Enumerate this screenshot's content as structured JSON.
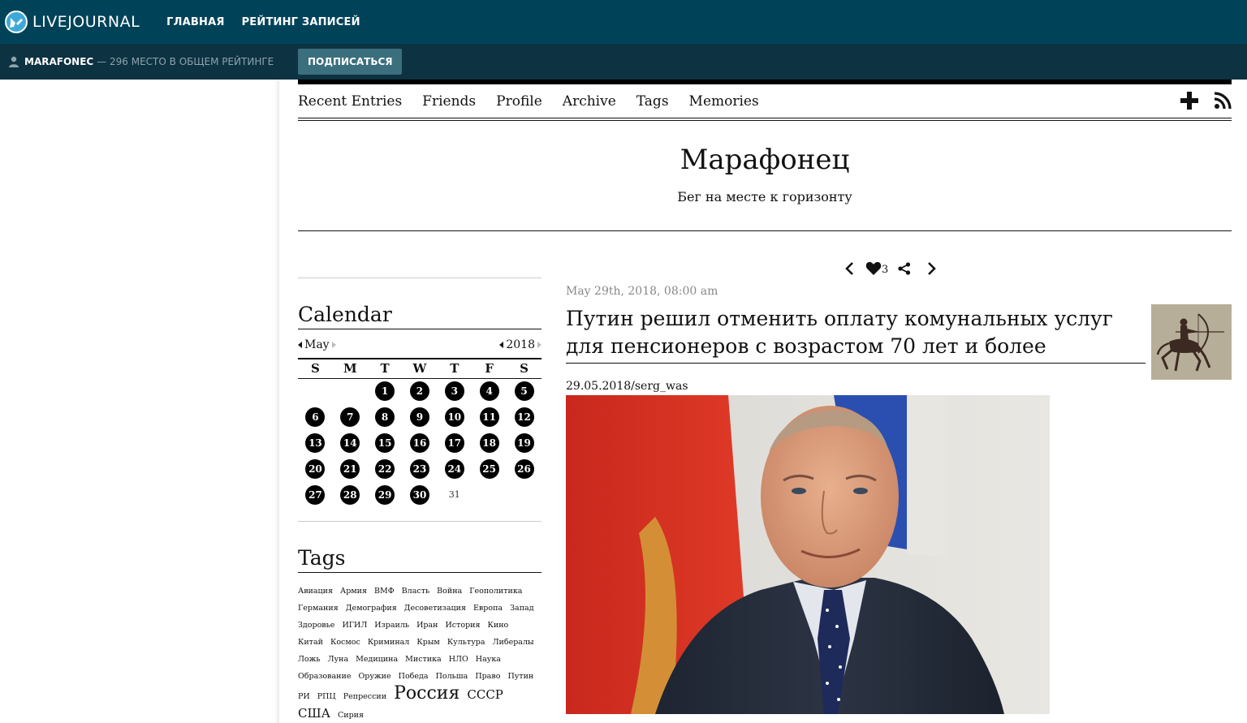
{
  "topbar": {
    "logo_text": "LIVEJOURNAL",
    "nav": [
      "ГЛАВНАЯ",
      "РЕЙТИНГ ЗАПИСЕЙ"
    ]
  },
  "subbar": {
    "journal_name": "MARAFONEC",
    "rating_text": "— 296 МЕСТО В ОБЩЕМ РЕЙТИНГЕ",
    "subscribe_label": "ПОДПИСАТЬСЯ"
  },
  "journal_nav": [
    "Recent Entries",
    "Friends",
    "Profile",
    "Archive",
    "Tags",
    "Memories"
  ],
  "blog": {
    "title": "Марафонец",
    "subtitle": "Бег на месте к горизонту"
  },
  "calendar": {
    "title": "Calendar",
    "month": "May",
    "year": "2018",
    "weekdays": [
      "S",
      "M",
      "T",
      "W",
      "T",
      "F",
      "S"
    ],
    "weeks": [
      [
        "",
        "",
        "1",
        "2",
        "3",
        "4",
        "5"
      ],
      [
        "6",
        "7",
        "8",
        "9",
        "10",
        "11",
        "12"
      ],
      [
        "13",
        "14",
        "15",
        "16",
        "17",
        "18",
        "19"
      ],
      [
        "20",
        "21",
        "22",
        "23",
        "24",
        "25",
        "26"
      ],
      [
        "27",
        "28",
        "29",
        "30",
        "31",
        "",
        ""
      ]
    ],
    "plain_days": [
      "31"
    ]
  },
  "tags": {
    "title": "Tags",
    "items": [
      "Авиация",
      "Армия",
      "ВМФ",
      "Власть",
      "Война",
      "Геополитика",
      "Германия",
      "Демография",
      "Десоветизация",
      "Европа",
      "Запад",
      "Здоровье",
      "ИГИЛ",
      "Израиль",
      "Иран",
      "История",
      "Кино",
      "Китай",
      "Космос",
      "Криминал",
      "Крым",
      "Культура",
      "Либералы",
      "Ложь",
      "Луна",
      "Медицина",
      "Мистика",
      "НЛО",
      "Наука",
      "Образование",
      "Оружие",
      "Победа",
      "Польша",
      "Право",
      "Путин",
      "РИ",
      "РПЦ",
      "Репрессии",
      "Россия",
      "СССР",
      "США",
      "Сирия"
    ],
    "large": [
      "Россия"
    ],
    "medium": [
      "СССР",
      "США"
    ]
  },
  "entry": {
    "likes": "3",
    "date": "May 29th, 2018, 08:00 am",
    "title": "Путин решил отменить оплату комунальных услуг для пенсионеров с возрастом 70 лет и более",
    "source": "29.05.2018/serg_was"
  }
}
